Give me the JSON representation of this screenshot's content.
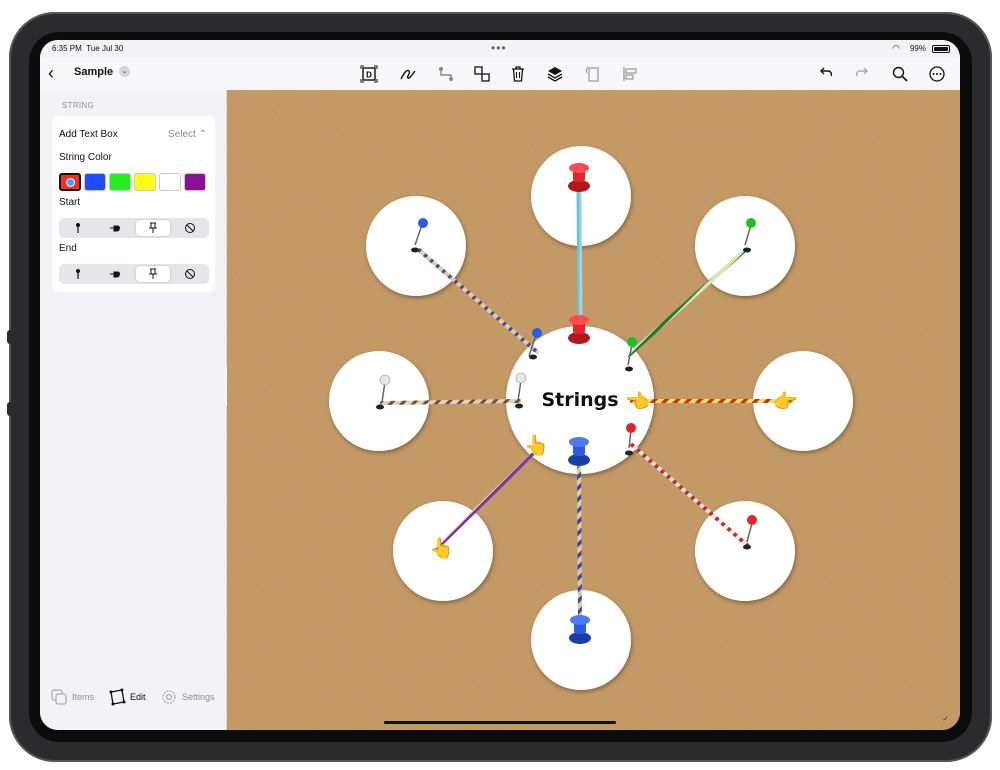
{
  "status": {
    "time": "6:35 PM",
    "date": "Tue Jul 30",
    "battery": "99%",
    "battery_level": 0.99
  },
  "toolbar": {
    "back_icon": "chevron-left-icon",
    "title": "Sample",
    "center_icons": [
      "text-box-icon",
      "pen-icon",
      "string-connector-icon",
      "group-icon",
      "trash-icon",
      "layers-icon",
      "rotate-icon",
      "align-left-icon"
    ],
    "right_icons": [
      "undo-icon",
      "redo-icon",
      "search-icon",
      "more-icon"
    ]
  },
  "sidebar": {
    "section_title": "STRING",
    "add_text_box": {
      "label": "Add Text Box",
      "value": "Select"
    },
    "string_color": {
      "label": "String Color",
      "swatches": [
        "#ff2b1c",
        "#1f4cff",
        "#22ee22",
        "#ffff11",
        "#ffffff",
        "#8b0f9b"
      ],
      "selected_index": 0
    },
    "start": {
      "label": "Start",
      "options": [
        "pin-icon",
        "pointing-hand-icon",
        "pushpin-icon",
        "none-icon"
      ],
      "selected_index": 2
    },
    "end": {
      "label": "End",
      "options": [
        "pin-icon",
        "pointing-hand-icon",
        "pushpin-icon",
        "none-icon"
      ],
      "selected_index": 2
    },
    "tabs": [
      {
        "label": "Items",
        "icon": "items-icon"
      },
      {
        "label": "Edit",
        "icon": "edit-icon",
        "active": true
      },
      {
        "label": "Settings",
        "icon": "settings-icon"
      }
    ]
  },
  "canvas": {
    "background": "corkboard",
    "center_label": "Strings",
    "colors": {
      "cork": "#c99a63",
      "pin_red": "#e2232b",
      "pin_blue": "#2a5be0",
      "pin_green": "#1fbd2e",
      "pin_white": "#e8e8e8"
    }
  }
}
